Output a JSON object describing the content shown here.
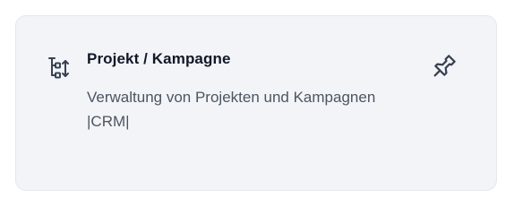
{
  "card": {
    "title": "Projekt / Kampagne",
    "description": "Verwaltung von Projekten und Kampagnen |CRM|",
    "app_icon": "hierarchy-sort-icon",
    "pin_icon": "pin-icon"
  },
  "colors": {
    "card_background": "#f3f4f7",
    "title": "#111827",
    "description": "#4b5563",
    "icon": "#374151"
  }
}
